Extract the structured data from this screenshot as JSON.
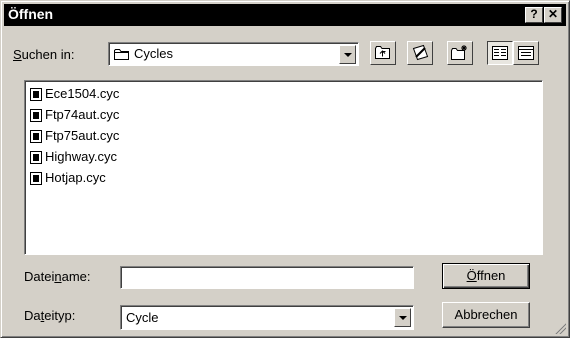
{
  "window": {
    "title": "Öffnen",
    "help_label": "?",
    "close_label": "✕"
  },
  "lookin": {
    "label_pre": "",
    "label_u": "S",
    "label_post": "uchen in:",
    "value": "Cycles",
    "icon": "folder-icon"
  },
  "toolbar": {
    "icons": [
      "up-one-level-icon",
      "desktop-icon",
      "new-folder-icon",
      "list-view-icon",
      "details-view-icon"
    ]
  },
  "files": [
    {
      "name": "Ece1504.cyc",
      "icon": "file-icon"
    },
    {
      "name": "Ftp74aut.cyc",
      "icon": "file-icon"
    },
    {
      "name": "Ftp75aut.cyc",
      "icon": "file-icon"
    },
    {
      "name": "Highway.cyc",
      "icon": "file-icon"
    },
    {
      "name": "Hotjap.cyc",
      "icon": "file-icon"
    }
  ],
  "filename": {
    "label_pre": "Datei",
    "label_u": "n",
    "label_post": "ame:",
    "value": ""
  },
  "filetype": {
    "label_pre": "Da",
    "label_u": "t",
    "label_post": "eityp:",
    "value": "Cycle"
  },
  "buttons": {
    "open_pre": "",
    "open_u": "Ö",
    "open_post": "ffnen",
    "cancel": "Abbrechen"
  }
}
